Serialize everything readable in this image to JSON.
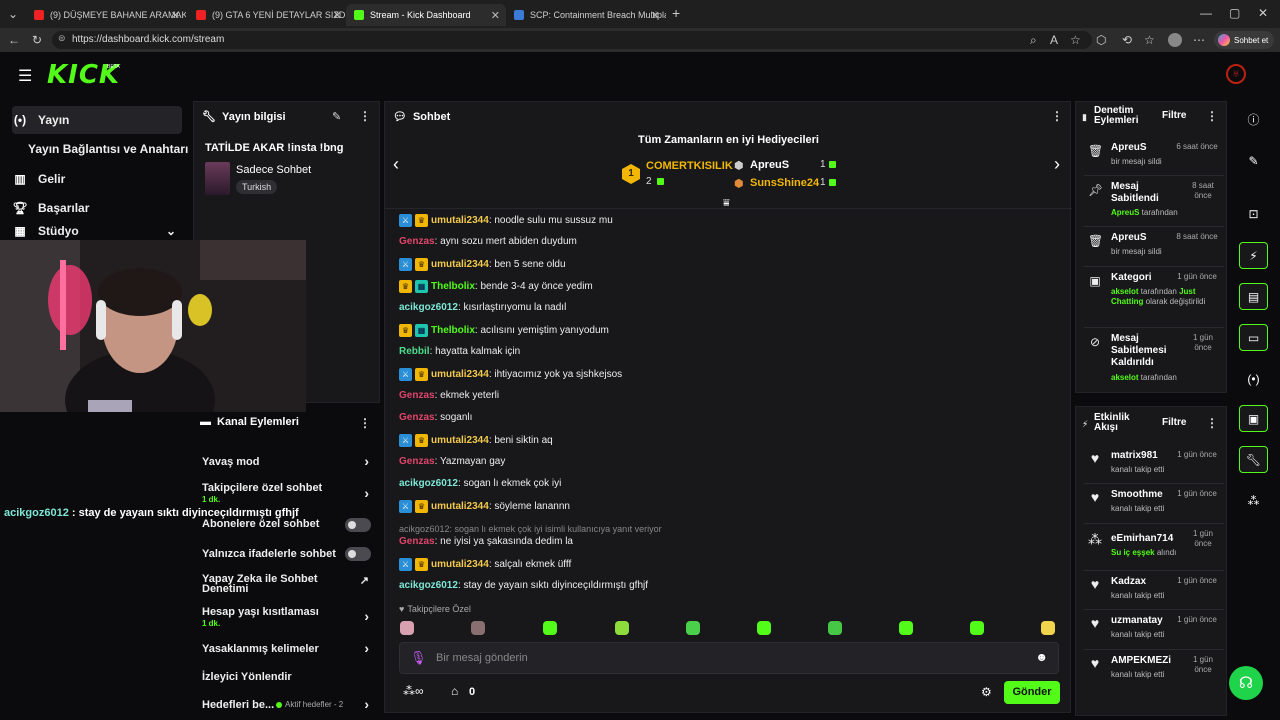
{
  "browser": {
    "tabs": [
      {
        "title": "(9) DÜŞMEYE BAHANE ARAMAK |"
      },
      {
        "title": "(9) GTA 6 YENİ DETAYLAR SIZDI! Y"
      },
      {
        "title": "Stream - Kick Dashboard"
      },
      {
        "title": "SCP: Containment Breach Multipla"
      }
    ],
    "url": "https://dashboard.kick.com/stream",
    "copilot_label": "Sohbet et"
  },
  "header": {
    "logo": "KICK",
    "beta": "BETA"
  },
  "nav": {
    "items": [
      {
        "label": "Yayın",
        "icon": "broadcast-icon"
      },
      {
        "label": "Yayın Bağlantısı ve Anahtarı",
        "icon": ""
      },
      {
        "label": "Gelir",
        "icon": "chart-icon"
      },
      {
        "label": "Başarılar",
        "icon": "trophy-icon"
      },
      {
        "label": "Stüdyo",
        "icon": "studio-icon"
      }
    ]
  },
  "stream_info": {
    "title": "Yayın bilgisi",
    "stream_title": "TATİLDE AKAR !insta !bng",
    "category": "Sadece Sohbet",
    "tag": "Turkish"
  },
  "overlay_chat": {
    "user": "acikgoz6012",
    "text": " : stay de yayaın sıktı diyinceçıldırmıştı gfhjf"
  },
  "channel_actions": {
    "title": "Kanal Eylemleri",
    "items": [
      {
        "label": "Yavaş mod",
        "sub": "",
        "control": "chevron"
      },
      {
        "label": "Takipçilere özel sohbet",
        "sub": "1 dk.",
        "control": "chevron"
      },
      {
        "label": "Abonelere özel sohbet",
        "sub": "",
        "control": "toggle"
      },
      {
        "label": "Yalnızca ifadelerle sohbet",
        "sub": "",
        "control": "toggle"
      },
      {
        "label": "Yapay Zeka ile Sohbet Denetimi",
        "sub": "",
        "control": "external"
      },
      {
        "label": "Hesap yaşı kısıtlaması",
        "sub": "1 dk.",
        "control": "chevron"
      },
      {
        "label": "Yasaklanmış kelimeler",
        "sub": "",
        "control": "chevron"
      },
      {
        "label": "İzleyici Yönlendir",
        "sub": "",
        "control": ""
      },
      {
        "label": "Hedefleri be...",
        "sub": "Aktif hedefler - 2",
        "control": "chevron"
      }
    ]
  },
  "chat": {
    "title": "Sohbet",
    "top_gifters_title": "Tüm Zamanların en iyi Hediyecileri",
    "gifters": [
      {
        "rank": "1",
        "name": "COMERTKISILIK",
        "count": "2"
      },
      {
        "rank": "",
        "name": "ApreuS",
        "count": "1"
      },
      {
        "rank": "",
        "name": "SunsShine24",
        "count": "1"
      }
    ],
    "messages": [
      {
        "user": "umutali2344",
        "color": "#f2c94c",
        "badges": [
          "blue",
          "gold"
        ],
        "text": ": noodle sulu mu sussuz mu"
      },
      {
        "user": "Genzas",
        "color": "#e0456a",
        "badges": [],
        "text": ": aynı sozu mert abiden duydum"
      },
      {
        "user": "umutali2344",
        "color": "#f2c94c",
        "badges": [
          "blue",
          "gold"
        ],
        "text": ": ben 5 sene oldu"
      },
      {
        "user": "Thelbolix",
        "color": "#53fc18",
        "badges": [
          "gold",
          "teal"
        ],
        "text": ": bende 3-4 ay önce yedim"
      },
      {
        "user": "acikgoz6012",
        "color": "#7ee8d6",
        "badges": [],
        "text": ": kısırlaştırıyomu la nadıl"
      },
      {
        "user": "Thelbolix",
        "color": "#53fc18",
        "badges": [
          "gold",
          "teal"
        ],
        "text": ": acılısını yemiştim yanıyodum"
      },
      {
        "user": "Rebbil",
        "color": "#4ddc8c",
        "badges": [],
        "text": ": hayatta kalmak için"
      },
      {
        "user": "umutali2344",
        "color": "#f2c94c",
        "badges": [
          "blue",
          "gold"
        ],
        "text": ": ihtiyacımız yok ya sjshkejsos"
      },
      {
        "user": "Genzas",
        "color": "#e0456a",
        "badges": [],
        "text": ": ekmek yeterli"
      },
      {
        "user": "Genzas",
        "color": "#e0456a",
        "badges": [],
        "text": ": soganlı"
      },
      {
        "user": "umutali2344",
        "color": "#f2c94c",
        "badges": [
          "blue",
          "gold"
        ],
        "text": ": beni siktin aq"
      },
      {
        "user": "Genzas",
        "color": "#e0456a",
        "badges": [],
        "text": ": Yazmayan gay"
      },
      {
        "user": "acikgoz6012",
        "color": "#7ee8d6",
        "badges": [],
        "text": ": sogan lı ekmek çok iyi"
      },
      {
        "user": "umutali2344",
        "color": "#f2c94c",
        "badges": [
          "blue",
          "gold"
        ],
        "text": ": söyleme lanannn"
      },
      {
        "user": "Genzas",
        "color": "#e0456a",
        "badges": [],
        "text": ": ne iyisi ya şakasında dedim la",
        "reply": "acikgoz6012: sogan lı ekmek çok iyi isimli kullanıcıya yanıt veriyor"
      },
      {
        "user": "umutali2344",
        "color": "#f2c94c",
        "badges": [
          "blue",
          "gold"
        ],
        "text": ": salçalı ekmek üfff"
      },
      {
        "user": "acikgoz6012",
        "color": "#7ee8d6",
        "badges": [],
        "text": ": stay de yayaın sıktı diyinceçıldırmıştı gfhjf"
      }
    ],
    "followers_only": "Takipçilere Özel",
    "input_placeholder": "Bir mesaj gönderin",
    "points": "0",
    "send_label": "Gönder"
  },
  "moderation": {
    "title": "Denetim Eylemleri",
    "filter": "Filtre",
    "items": [
      {
        "icon": "trash-icon",
        "name": "ApreuS",
        "time": "6 saat önce",
        "sub": "bir mesajı sildi"
      },
      {
        "icon": "pin-icon",
        "name": "Mesaj Sabitlendi",
        "time": "8 saat önce",
        "sub_user": "ApreuS",
        "sub": " tarafından"
      },
      {
        "icon": "trash-icon",
        "name": "ApreuS",
        "time": "8 saat önce",
        "sub": "bir mesajı sildi"
      },
      {
        "icon": "category-icon",
        "name": "Kategori",
        "time": "1 gün önce",
        "sub_user": "akselot",
        "sub": " tarafından ",
        "sub_green": "Just Chatting",
        "sub_tail": " olarak değiştirildi"
      },
      {
        "icon": "unpin-icon",
        "name": "Mesaj Sabitlemesi Kaldırıldı",
        "time": "1 gün önce",
        "sub_user": "akselot",
        "sub": " tarafından"
      }
    ]
  },
  "activity": {
    "title": "Etkinlik Akışı",
    "filter": "Filtre",
    "items": [
      {
        "icon": "heart-icon",
        "name": "matrix981",
        "time": "1 gün önce",
        "sub": "kanalı takip etti"
      },
      {
        "icon": "heart-icon",
        "name": "Smoothme",
        "time": "1 gün önce",
        "sub": "kanalı takip etti"
      },
      {
        "icon": "gift-icon",
        "name": "eEmirhan714",
        "time": "1 gün önce",
        "sub_green": "Su iç eşşek",
        "sub": " alındı"
      },
      {
        "icon": "heart-icon",
        "name": "Kadzax",
        "time": "1 gün önce",
        "sub": "kanalı takip etti"
      },
      {
        "icon": "heart-icon",
        "name": "uzmanatay",
        "time": "1 gün önce",
        "sub": "kanalı takip etti"
      },
      {
        "icon": "heart-icon",
        "name": "AMPEKMEZi",
        "time": "1 gün önce",
        "sub": "kanalı takip etti"
      }
    ]
  }
}
